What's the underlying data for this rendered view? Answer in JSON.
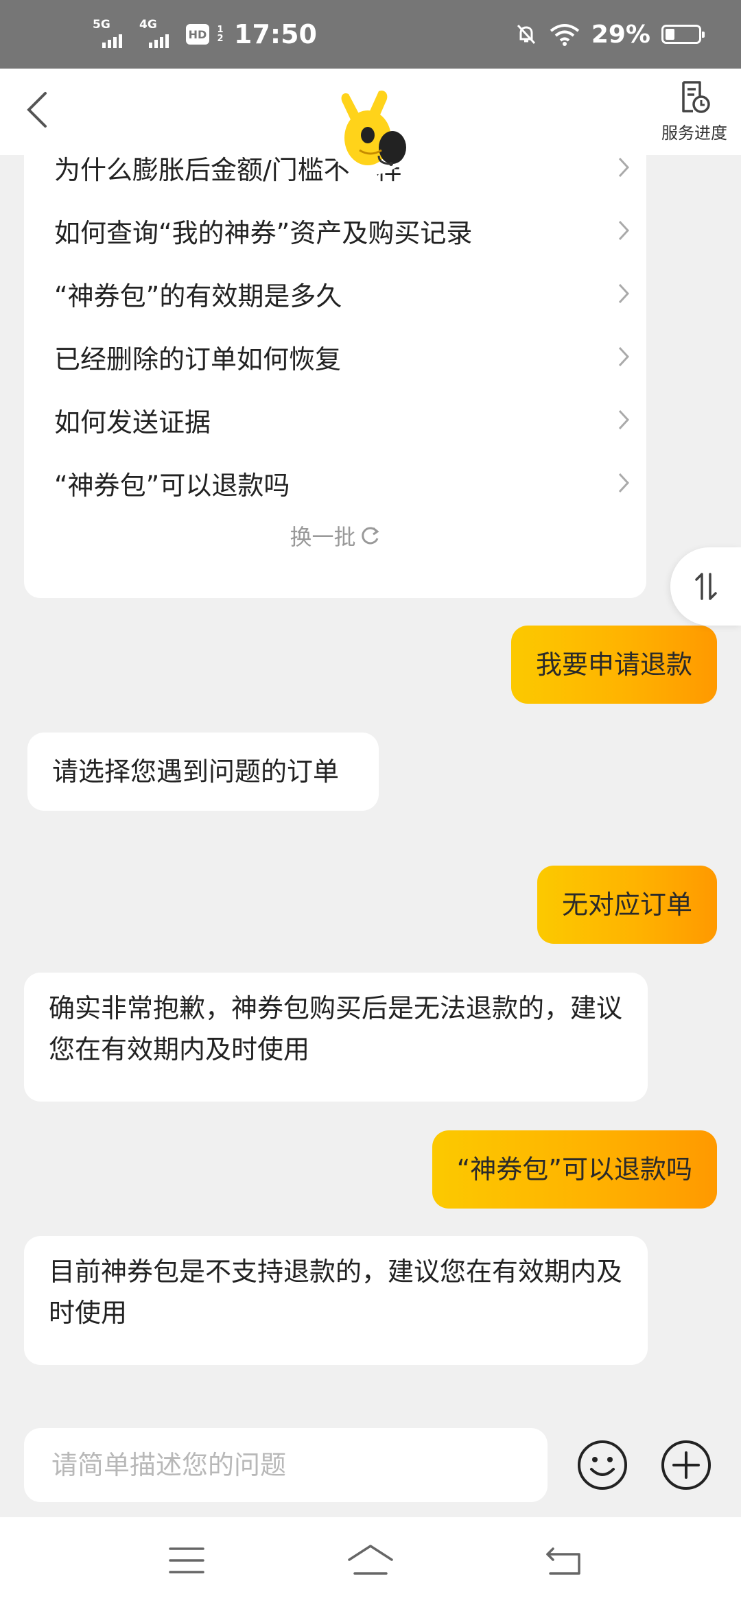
{
  "status_bar": {
    "net1": "5G",
    "net2": "4G",
    "hd": "HD",
    "hd_frac": "1\n2",
    "time": "17:50",
    "battery_pct": "29%",
    "battery_level": 0.29
  },
  "header": {
    "service_label": "服务进度"
  },
  "faq": {
    "items": [
      "为什么膨胀后金额/门槛不一样",
      "如何查询“我的神券”资产及购买记录",
      "“神券包”的有效期是多久",
      "已经删除的订单如何恢复",
      "如何发送证据",
      "“神券包”可以退款吗"
    ],
    "refresh_label": "换一批"
  },
  "messages": [
    {
      "from": "user",
      "text": "我要申请退款"
    },
    {
      "from": "bot",
      "text": "请选择您遇到问题的订单"
    },
    {
      "from": "user",
      "text": "无对应订单"
    },
    {
      "from": "bot",
      "text": "确实非常抱歉，神券包购买后是无法退款的，建议您在有效期内及时使用"
    },
    {
      "from": "user",
      "text": "“神券包”可以退款吗"
    },
    {
      "from": "bot",
      "text": "目前神券包是不支持退款的，建议您在有效期内及时使用"
    }
  ],
  "input": {
    "placeholder": "请简单描述您的问题",
    "value": ""
  },
  "colors": {
    "accent_start": "#fcc900",
    "accent_end": "#ff9900",
    "background": "#f0f0f0",
    "status_bar": "#767676"
  },
  "icons": {
    "back": "back-arrow-icon",
    "service": "service-progress-icon",
    "mascot": "mascot-avatar-icon",
    "sort": "swap-sort-icon",
    "emoji": "emoji-icon",
    "add": "plus-icon",
    "nav_menu": "menu-icon",
    "nav_home": "home-icon",
    "nav_back": "return-icon"
  }
}
